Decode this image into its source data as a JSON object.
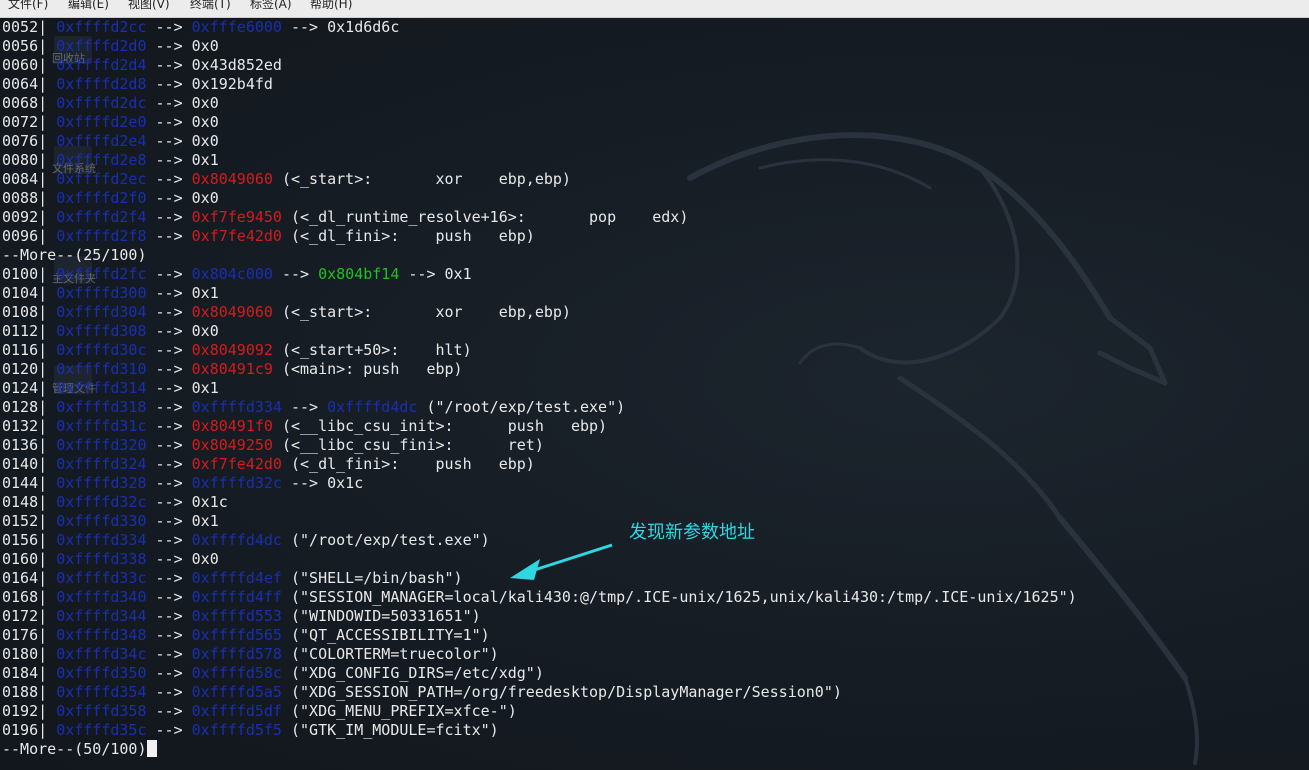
{
  "menu": [
    "文件(F)",
    "编辑(E)",
    "视图(V)",
    "终端(T)",
    "标签(A)",
    "帮助(H)"
  ],
  "desktop_icons": [
    "回收站",
    "文件系统",
    "主文件夹",
    "管理文件"
  ],
  "lines": [
    {
      "type": "row",
      "off": "0052",
      "addr": "0xffffd2cc",
      "chain": [
        {
          "t": "data",
          "v": "0xfffe6000"
        }
      ],
      "tail": " --> 0x1d6d6c"
    },
    {
      "type": "row",
      "off": "0056",
      "addr": "0xffffd2d0",
      "chain": [],
      "tail": " --> 0x0"
    },
    {
      "type": "row",
      "off": "0060",
      "addr": "0xffffd2d4",
      "chain": [],
      "tail": " --> 0x43d852ed"
    },
    {
      "type": "row",
      "off": "0064",
      "addr": "0xffffd2d8",
      "chain": [],
      "tail": " --> 0x192b4fd"
    },
    {
      "type": "row",
      "off": "0068",
      "addr": "0xffffd2dc",
      "chain": [],
      "tail": " --> 0x0"
    },
    {
      "type": "row",
      "off": "0072",
      "addr": "0xffffd2e0",
      "chain": [],
      "tail": " --> 0x0"
    },
    {
      "type": "row",
      "off": "0076",
      "addr": "0xffffd2e4",
      "chain": [],
      "tail": " --> 0x0"
    },
    {
      "type": "row",
      "off": "0080",
      "addr": "0xffffd2e8",
      "chain": [],
      "tail": " --> 0x1"
    },
    {
      "type": "row",
      "off": "0084",
      "addr": "0xffffd2ec",
      "chain": [
        {
          "t": "code",
          "v": "0x8049060"
        }
      ],
      "tail": " (<_start>:       xor    ebp,ebp)"
    },
    {
      "type": "row",
      "off": "0088",
      "addr": "0xffffd2f0",
      "chain": [],
      "tail": " --> 0x0"
    },
    {
      "type": "row",
      "off": "0092",
      "addr": "0xffffd2f4",
      "chain": [
        {
          "t": "code",
          "v": "0xf7fe9450"
        }
      ],
      "tail": " (<_dl_runtime_resolve+16>:       pop    edx)"
    },
    {
      "type": "row",
      "off": "0096",
      "addr": "0xffffd2f8",
      "chain": [
        {
          "t": "code",
          "v": "0xf7fe42d0"
        }
      ],
      "tail": " (<_dl_fini>:    push   ebp)"
    },
    {
      "type": "more",
      "text": "--More--(25/100)"
    },
    {
      "type": "row",
      "off": "0100",
      "addr": "0xffffd2fc",
      "chain": [
        {
          "t": "data",
          "v": "0x804c000"
        },
        {
          "t": "rodata",
          "v": "0x804bf14"
        }
      ],
      "tail": " --> 0x1"
    },
    {
      "type": "row",
      "off": "0104",
      "addr": "0xffffd300",
      "chain": [],
      "tail": " --> 0x1"
    },
    {
      "type": "row",
      "off": "0108",
      "addr": "0xffffd304",
      "chain": [
        {
          "t": "code",
          "v": "0x8049060"
        }
      ],
      "tail": " (<_start>:       xor    ebp,ebp)"
    },
    {
      "type": "row",
      "off": "0112",
      "addr": "0xffffd308",
      "chain": [],
      "tail": " --> 0x0"
    },
    {
      "type": "row",
      "off": "0116",
      "addr": "0xffffd30c",
      "chain": [
        {
          "t": "code",
          "v": "0x8049092"
        }
      ],
      "tail": " (<_start+50>:    hlt)"
    },
    {
      "type": "row",
      "off": "0120",
      "addr": "0xffffd310",
      "chain": [
        {
          "t": "code",
          "v": "0x80491c9"
        }
      ],
      "tail": " (<main>: push   ebp)"
    },
    {
      "type": "row",
      "off": "0124",
      "addr": "0xffffd314",
      "chain": [],
      "tail": " --> 0x1"
    },
    {
      "type": "row",
      "off": "0128",
      "addr": "0xffffd318",
      "chain": [
        {
          "t": "data",
          "v": "0xffffd334"
        },
        {
          "t": "data",
          "v": "0xffffd4dc"
        }
      ],
      "tail": " (\"/root/exp/test.exe\")"
    },
    {
      "type": "row",
      "off": "0132",
      "addr": "0xffffd31c",
      "chain": [
        {
          "t": "code",
          "v": "0x80491f0"
        }
      ],
      "tail": " (<__libc_csu_init>:      push   ebp)"
    },
    {
      "type": "row",
      "off": "0136",
      "addr": "0xffffd320",
      "chain": [
        {
          "t": "code",
          "v": "0x8049250"
        }
      ],
      "tail": " (<__libc_csu_fini>:      ret)"
    },
    {
      "type": "row",
      "off": "0140",
      "addr": "0xffffd324",
      "chain": [
        {
          "t": "code",
          "v": "0xf7fe42d0"
        }
      ],
      "tail": " (<_dl_fini>:    push   ebp)"
    },
    {
      "type": "row",
      "off": "0144",
      "addr": "0xffffd328",
      "chain": [
        {
          "t": "data",
          "v": "0xffffd32c"
        }
      ],
      "tail": " --> 0x1c"
    },
    {
      "type": "row",
      "off": "0148",
      "addr": "0xffffd32c",
      "chain": [],
      "tail": " --> 0x1c"
    },
    {
      "type": "row",
      "off": "0152",
      "addr": "0xffffd330",
      "chain": [],
      "tail": " --> 0x1"
    },
    {
      "type": "row",
      "off": "0156",
      "addr": "0xffffd334",
      "chain": [
        {
          "t": "data",
          "v": "0xffffd4dc"
        }
      ],
      "tail": " (\"/root/exp/test.exe\")"
    },
    {
      "type": "row",
      "off": "0160",
      "addr": "0xffffd338",
      "chain": [],
      "tail": " --> 0x0"
    },
    {
      "type": "row",
      "off": "0164",
      "addr": "0xffffd33c",
      "chain": [
        {
          "t": "data",
          "v": "0xffffd4ef"
        }
      ],
      "tail": " (\"SHELL=/bin/bash\")"
    },
    {
      "type": "row",
      "off": "0168",
      "addr": "0xffffd340",
      "chain": [
        {
          "t": "data",
          "v": "0xffffd4ff"
        }
      ],
      "tail": " (\"SESSION_MANAGER=local/kali430:@/tmp/.ICE-unix/1625,unix/kali430:/tmp/.ICE-unix/1625\")"
    },
    {
      "type": "row",
      "off": "0172",
      "addr": "0xffffd344",
      "chain": [
        {
          "t": "data",
          "v": "0xffffd553"
        }
      ],
      "tail": " (\"WINDOWID=50331651\")"
    },
    {
      "type": "row",
      "off": "0176",
      "addr": "0xffffd348",
      "chain": [
        {
          "t": "data",
          "v": "0xffffd565"
        }
      ],
      "tail": " (\"QT_ACCESSIBILITY=1\")"
    },
    {
      "type": "row",
      "off": "0180",
      "addr": "0xffffd34c",
      "chain": [
        {
          "t": "data",
          "v": "0xffffd578"
        }
      ],
      "tail": " (\"COLORTERM=truecolor\")"
    },
    {
      "type": "row",
      "off": "0184",
      "addr": "0xffffd350",
      "chain": [
        {
          "t": "data",
          "v": "0xffffd58c"
        }
      ],
      "tail": " (\"XDG_CONFIG_DIRS=/etc/xdg\")"
    },
    {
      "type": "row",
      "off": "0188",
      "addr": "0xffffd354",
      "chain": [
        {
          "t": "data",
          "v": "0xffffd5a5"
        }
      ],
      "tail": " (\"XDG_SESSION_PATH=/org/freedesktop/DisplayManager/Session0\")"
    },
    {
      "type": "row",
      "off": "0192",
      "addr": "0xffffd358",
      "chain": [
        {
          "t": "data",
          "v": "0xffffd5df"
        }
      ],
      "tail": " (\"XDG_MENU_PREFIX=xfce-\")"
    },
    {
      "type": "row",
      "off": "0196",
      "addr": "0xffffd35c",
      "chain": [
        {
          "t": "data",
          "v": "0xffffd5f5"
        }
      ],
      "tail": " (\"GTK_IM_MODULE=fcitx\")"
    },
    {
      "type": "more",
      "text": "--More--(50/100)",
      "cursor": true
    }
  ],
  "annotation": {
    "text": "发现新参数地址",
    "color": "#2fd7e3"
  },
  "colors": {
    "background": "#151b22",
    "stack_addr": "#1a2fb0",
    "code_addr": "#d41c1c",
    "rodata_addr": "#1fc21f",
    "text": "#e8e8e8"
  }
}
